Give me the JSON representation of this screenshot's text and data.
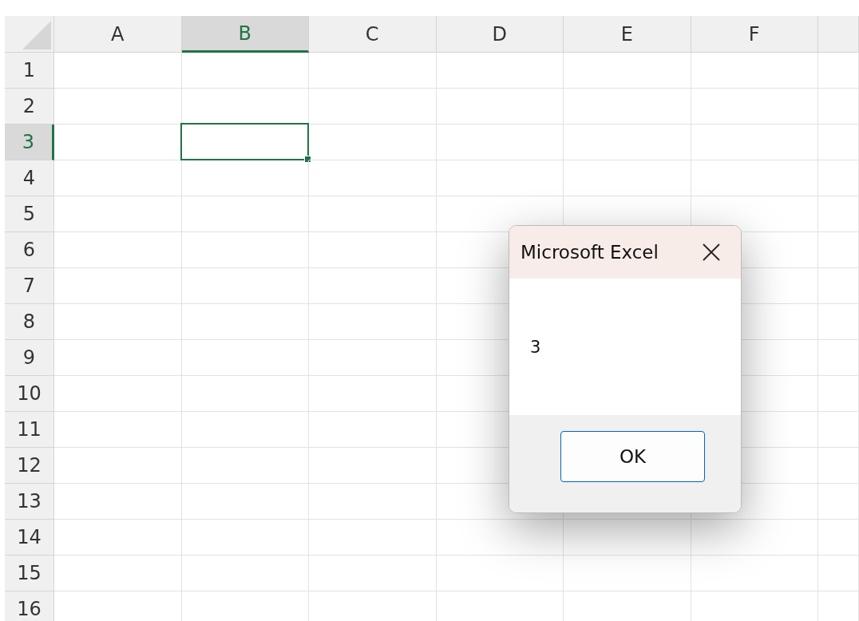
{
  "columns": [
    {
      "label": "A",
      "selected": false
    },
    {
      "label": "B",
      "selected": true
    },
    {
      "label": "C",
      "selected": false
    },
    {
      "label": "D",
      "selected": false
    },
    {
      "label": "E",
      "selected": false
    },
    {
      "label": "F",
      "selected": false
    }
  ],
  "rows": [
    {
      "label": "1",
      "selected": false
    },
    {
      "label": "2",
      "selected": false
    },
    {
      "label": "3",
      "selected": true
    },
    {
      "label": "4",
      "selected": false
    },
    {
      "label": "5",
      "selected": false
    },
    {
      "label": "6",
      "selected": false
    },
    {
      "label": "7",
      "selected": false
    },
    {
      "label": "8",
      "selected": false
    },
    {
      "label": "9",
      "selected": false
    },
    {
      "label": "10",
      "selected": false
    },
    {
      "label": "11",
      "selected": false
    },
    {
      "label": "12",
      "selected": false
    },
    {
      "label": "13",
      "selected": false
    },
    {
      "label": "14",
      "selected": false
    },
    {
      "label": "15",
      "selected": false
    },
    {
      "label": "16",
      "selected": false
    }
  ],
  "dialog": {
    "title": "Microsoft Excel",
    "message": "3",
    "buttons": [
      "OK"
    ]
  }
}
